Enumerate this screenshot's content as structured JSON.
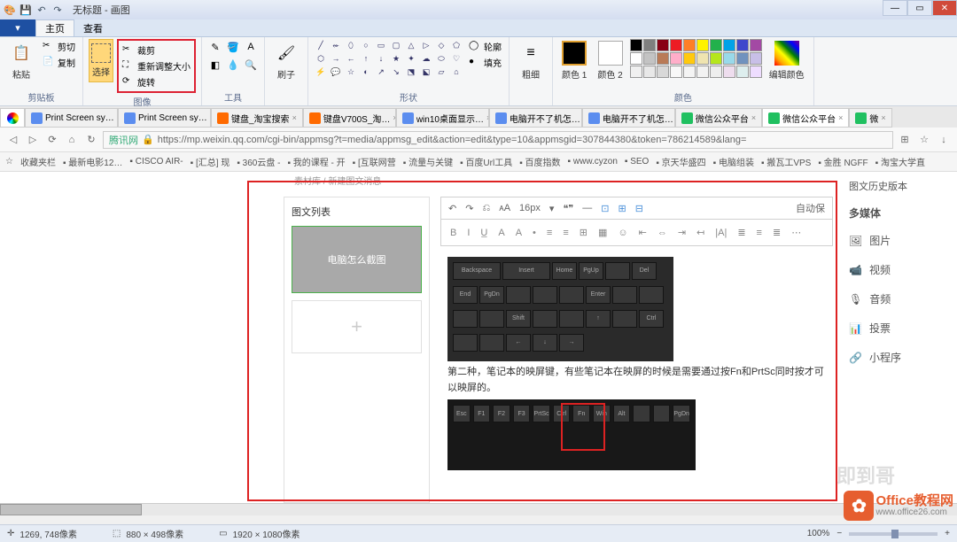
{
  "window": {
    "title": "无标题 - 画图",
    "min_icon": "—",
    "max_icon": "▭",
    "close_icon": "✕"
  },
  "ribbon_tabs": {
    "file_menu": "▾",
    "home": "主页",
    "view": "查看"
  },
  "ribbon": {
    "clipboard": {
      "paste": "粘贴",
      "cut": "剪切",
      "copy": "复制",
      "label": "剪贴板"
    },
    "image": {
      "select": "选择",
      "crop": "裁剪",
      "resize": "重新调整大小",
      "rotate": "旋转",
      "label": "图像"
    },
    "tools": {
      "label": "工具"
    },
    "brush": {
      "label": "刷子"
    },
    "shapes": {
      "outline": "轮廓",
      "fill": "填充",
      "label": "形状"
    },
    "size": {
      "label": "粗细"
    },
    "colors": {
      "color1": "颜色 1",
      "color2": "颜色 2",
      "edit": "编辑颜色",
      "label": "颜色",
      "palette": [
        "#000000",
        "#7f7f7f",
        "#880015",
        "#ed1c24",
        "#ff7f27",
        "#fff200",
        "#22b14c",
        "#00a2e8",
        "#3f48cc",
        "#a349a4",
        "#ffffff",
        "#c3c3c3",
        "#b97a57",
        "#ffaec9",
        "#ffc90e",
        "#efe4b0",
        "#b5e61d",
        "#99d9ea",
        "#7092be",
        "#c8bfe7",
        "#f0f0f0",
        "#e8e8e8",
        "#d8d8d8",
        "#f8f8f8",
        "#f4f4f4",
        "#f2f2f2",
        "#eee",
        "#ede",
        "#dee",
        "#edf"
      ]
    }
  },
  "browser": {
    "tabs": [
      {
        "label": "Print Screen sy…",
        "icon": "#5b8def"
      },
      {
        "label": "Print Screen sy…",
        "icon": "#5b8def"
      },
      {
        "label": "键盘_淘宝搜索",
        "icon": "#ff6a00"
      },
      {
        "label": "键盘V700S_淘…",
        "icon": "#ff6a00"
      },
      {
        "label": "win10桌面显示…",
        "icon": "#5b8def"
      },
      {
        "label": "电脑开不了机怎…",
        "icon": "#5b8def"
      },
      {
        "label": "电脑开不了机怎…",
        "icon": "#5b8def"
      },
      {
        "label": "微信公众平台",
        "icon": "#20c060"
      },
      {
        "label": "微信公众平台",
        "icon": "#20c060"
      },
      {
        "label": "微",
        "icon": "#20c060"
      }
    ],
    "url_label": "腾讯网",
    "url": "https://mp.weixin.qq.com/cgi-bin/appmsg?t=media/appmsg_edit&action=edit&type=10&appmsgid=307844380&token=786214589&lang=",
    "bookmarks": [
      "收藏夹栏",
      "最新电影12…",
      "CISCO AIR-",
      "[汇总] 现",
      "360云盘 -",
      "我的课程 - 开",
      "[互联网营",
      "流量与关键",
      "百度Url工具",
      "百度指数",
      "www.cyzon",
      "SEO",
      "京天华盛四",
      "电脑组装",
      "搬瓦工VPS",
      "金胜 NGFF",
      "淘宝大学直"
    ]
  },
  "editor": {
    "breadcrumb_a": "素材库",
    "breadcrumb_sep": " / ",
    "breadcrumb_b": "新建图文消息",
    "panel_title": "图文列表",
    "card_text": "电脑怎么截图",
    "tb1": {
      "undo": "↶",
      "redo": "↷",
      "format": "⎌",
      "fs_icon": "ᴀA",
      "fontsize": "16px",
      "quote": "❝❞",
      "hr": "—",
      "autosave": "自动保"
    },
    "tb2": [
      "B",
      "I",
      "U̲",
      "A",
      "A",
      "•",
      "≡",
      "≡",
      "⊞",
      "▦",
      "☺",
      "⇤",
      "⇔",
      "⇥",
      "↤",
      "|A|",
      "≣",
      "≡",
      "≣",
      "⋯"
    ],
    "body_text": "第二种，笔记本的映屏键，有些笔记本在映屏的时候是需要通过按Fn和PrtSc同时按才可以映屏的。",
    "keys1": [
      "Backspace",
      "Insert",
      "Home",
      "PgUp",
      "",
      "Del",
      "End",
      "PgDn",
      "",
      "",
      "",
      "Enter",
      "",
      "",
      "",
      "",
      "Shift",
      "",
      "",
      "↑",
      "",
      "Ctrl",
      "",
      "",
      "←",
      "↓",
      "→"
    ],
    "keys2": [
      "Esc",
      "F1",
      "F2",
      "F3",
      "PrtSc",
      "Ctrl",
      "Fn",
      "Win",
      "Alt",
      "",
      "",
      "PgDn"
    ]
  },
  "sidebar": {
    "history": "图文历史版本",
    "section": "多媒体",
    "items": [
      {
        "icon": "🖼",
        "label": "图片"
      },
      {
        "icon": "📹",
        "label": "视频"
      },
      {
        "icon": "🎙",
        "label": "音频"
      },
      {
        "icon": "📊",
        "label": "投票"
      },
      {
        "icon": "🔗",
        "label": "小程序"
      }
    ]
  },
  "status": {
    "coords": "1269, 748像素",
    "selection": "880 × 498像素",
    "canvas": "1920 × 1080像素",
    "zoom": "100%"
  },
  "watermark": {
    "name": "Office教程网",
    "url": "www.office26.com",
    "ghost": "即到哥"
  }
}
